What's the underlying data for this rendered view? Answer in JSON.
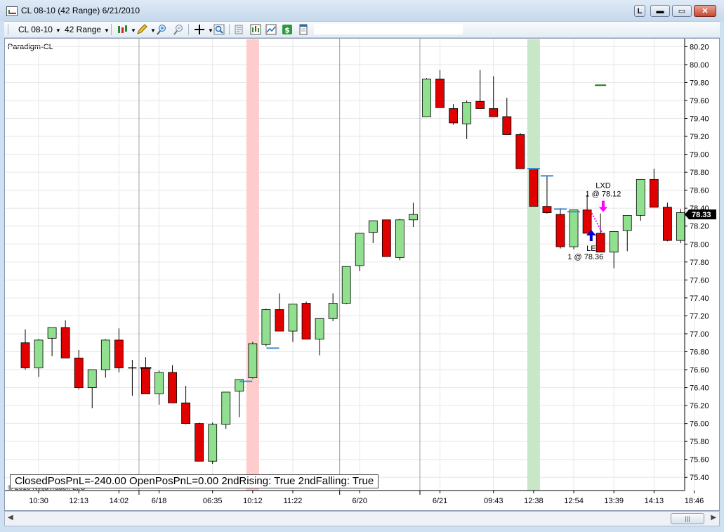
{
  "window": {
    "title": "CL 08-10 (42 Range)  6/21/2010",
    "btn_l": "L",
    "btn_min": "▬",
    "btn_max": "▭",
    "btn_close": "✕"
  },
  "toolbar": {
    "instrument": "CL 08-10",
    "interval": "42 Range",
    "icons": [
      "candle-style-icon",
      "pencil-icon",
      "zoom-in-icon",
      "zoom-out-icon",
      "crosshair-icon",
      "magnifier-icon",
      "properties-icon",
      "strategies-icon",
      "indicators-icon",
      "dollar-icon",
      "data-box-icon"
    ]
  },
  "colors": {
    "up": "#90e090",
    "down": "#e00000",
    "wick": "#000000",
    "red_band": "#ffcccc",
    "green_band": "#c8e6c8",
    "stop_marker": "#3a8fd8",
    "long_arrow": "#0000cc",
    "exit_arrow": "#ff00ff",
    "last_price_bg": "#000000"
  },
  "chart_data": {
    "type": "candlestick",
    "title": "Paradigm-CL",
    "copyright": "© 2010 NinjaTrader, LLC",
    "ylim": [
      75.3,
      80.25
    ],
    "y_ticks": [
      "80.20",
      "80.00",
      "79.80",
      "79.60",
      "79.40",
      "79.20",
      "79.00",
      "78.80",
      "78.60",
      "78.40",
      "78.20",
      "78.00",
      "77.80",
      "77.60",
      "77.40",
      "77.20",
      "77.00",
      "76.80",
      "76.60",
      "76.40",
      "76.20",
      "76.00",
      "75.80",
      "75.60",
      "75.40"
    ],
    "x_ticks": [
      {
        "bar": 1,
        "label": "10:30"
      },
      {
        "bar": 4,
        "label": "12:13"
      },
      {
        "bar": 7,
        "label": "14:02"
      },
      {
        "bar": 10,
        "label": "6/18"
      },
      {
        "bar": 14,
        "label": "06:35"
      },
      {
        "bar": 17,
        "label": "10:12"
      },
      {
        "bar": 20,
        "label": "11:22"
      },
      {
        "bar": 25,
        "label": "6/20"
      },
      {
        "bar": 31,
        "label": "6/21"
      },
      {
        "bar": 35,
        "label": "09:43"
      },
      {
        "bar": 38,
        "label": "12:38"
      },
      {
        "bar": 41,
        "label": "12:54"
      },
      {
        "bar": 44,
        "label": "13:39"
      },
      {
        "bar": 47,
        "label": "14:13"
      },
      {
        "bar": 50,
        "label": "18:46"
      }
    ],
    "session_breaks": [
      9,
      24,
      30
    ],
    "bars": [
      {
        "o": 76.9,
        "h": 77.05,
        "l": 76.6,
        "c": 76.62
      },
      {
        "o": 76.62,
        "h": 76.94,
        "l": 76.52,
        "c": 76.93
      },
      {
        "o": 76.95,
        "h": 77.07,
        "l": 76.75,
        "c": 77.07
      },
      {
        "o": 77.07,
        "h": 77.15,
        "l": 76.73,
        "c": 76.73
      },
      {
        "o": 76.73,
        "h": 76.82,
        "l": 76.38,
        "c": 76.4
      },
      {
        "o": 76.4,
        "h": 76.6,
        "l": 76.17,
        "c": 76.6
      },
      {
        "o": 76.6,
        "h": 76.94,
        "l": 76.51,
        "c": 76.93
      },
      {
        "o": 76.93,
        "h": 77.06,
        "l": 76.57,
        "c": 76.62
      },
      {
        "o": 76.62,
        "h": 76.71,
        "l": 76.31,
        "c": 76.62
      },
      {
        "o": 76.62,
        "h": 76.74,
        "l": 76.33,
        "c": 76.33
      },
      {
        "o": 76.33,
        "h": 76.59,
        "l": 76.21,
        "c": 76.57
      },
      {
        "o": 76.57,
        "h": 76.65,
        "l": 76.24,
        "c": 76.23
      },
      {
        "o": 76.23,
        "h": 76.42,
        "l": 75.99,
        "c": 76.0
      },
      {
        "o": 76.0,
        "h": 76.01,
        "l": 75.58,
        "c": 75.58
      },
      {
        "o": 75.58,
        "h": 76.01,
        "l": 75.55,
        "c": 75.99
      },
      {
        "o": 75.99,
        "h": 76.35,
        "l": 75.94,
        "c": 76.35
      },
      {
        "o": 76.36,
        "h": 76.49,
        "l": 76.07,
        "c": 76.49
      },
      {
        "o": 76.51,
        "h": 76.91,
        "l": 76.5,
        "c": 76.89
      },
      {
        "o": 76.88,
        "h": 77.28,
        "l": 76.86,
        "c": 77.27
      },
      {
        "o": 77.27,
        "h": 77.45,
        "l": 77.03,
        "c": 77.03
      },
      {
        "o": 77.03,
        "h": 77.33,
        "l": 76.91,
        "c": 77.33
      },
      {
        "o": 77.34,
        "h": 77.36,
        "l": 76.94,
        "c": 76.94
      },
      {
        "o": 76.94,
        "h": 77.17,
        "l": 76.76,
        "c": 77.17
      },
      {
        "o": 77.17,
        "h": 77.45,
        "l": 77.14,
        "c": 77.34
      },
      {
        "o": 77.34,
        "h": 77.75,
        "l": 77.33,
        "c": 77.75
      },
      {
        "o": 77.76,
        "h": 78.12,
        "l": 77.7,
        "c": 78.12
      },
      {
        "o": 78.13,
        "h": 78.26,
        "l": 78.01,
        "c": 78.26
      },
      {
        "o": 78.27,
        "h": 78.27,
        "l": 77.86,
        "c": 77.86
      },
      {
        "o": 77.85,
        "h": 78.28,
        "l": 77.82,
        "c": 78.27
      },
      {
        "o": 78.27,
        "h": 78.46,
        "l": 78.19,
        "c": 78.33
      },
      {
        "o": 79.42,
        "h": 79.85,
        "l": 79.42,
        "c": 79.84
      },
      {
        "o": 79.84,
        "h": 79.94,
        "l": 79.52,
        "c": 79.52
      },
      {
        "o": 79.51,
        "h": 79.56,
        "l": 79.33,
        "c": 79.35
      },
      {
        "o": 79.34,
        "h": 79.6,
        "l": 79.17,
        "c": 79.58
      },
      {
        "o": 79.59,
        "h": 79.94,
        "l": 79.52,
        "c": 79.51
      },
      {
        "o": 79.51,
        "h": 79.87,
        "l": 79.42,
        "c": 79.42
      },
      {
        "o": 79.42,
        "h": 79.63,
        "l": 79.22,
        "c": 79.22
      },
      {
        "o": 79.22,
        "h": 79.24,
        "l": 78.84,
        "c": 78.84
      },
      {
        "o": 78.84,
        "h": 78.84,
        "l": 78.42,
        "c": 78.42
      },
      {
        "o": 78.42,
        "h": 78.76,
        "l": 78.34,
        "c": 78.35
      },
      {
        "o": 78.33,
        "h": 78.4,
        "l": 77.95,
        "c": 77.97
      },
      {
        "o": 77.97,
        "h": 78.38,
        "l": 77.94,
        "c": 78.38
      },
      {
        "o": 78.38,
        "h": 78.55,
        "l": 78.12,
        "c": 78.12
      },
      {
        "o": 78.12,
        "h": 78.34,
        "l": 77.91,
        "c": 77.91
      },
      {
        "o": 77.91,
        "h": 78.14,
        "l": 77.73,
        "c": 78.14
      },
      {
        "o": 78.15,
        "h": 78.32,
        "l": 77.92,
        "c": 78.32
      },
      {
        "o": 78.32,
        "h": 78.72,
        "l": 78.26,
        "c": 78.72
      },
      {
        "o": 78.72,
        "h": 78.84,
        "l": 78.42,
        "c": 78.41
      },
      {
        "o": 78.41,
        "h": 78.46,
        "l": 78.03,
        "c": 78.04
      },
      {
        "o": 78.04,
        "h": 78.39,
        "l": 78.01,
        "c": 78.35
      }
    ],
    "bands": [
      {
        "bar": 17,
        "color": "red"
      },
      {
        "bar": 38,
        "color": "green"
      }
    ],
    "stop_markers": [
      {
        "bar": 16.5,
        "y": 76.47
      },
      {
        "bar": 18.5,
        "y": 76.84
      },
      {
        "bar": 38,
        "y": 78.84
      },
      {
        "bar": 39,
        "y": 78.76
      },
      {
        "bar": 40,
        "y": 78.39
      },
      {
        "bar": 41,
        "y": 78.36
      }
    ],
    "dark_markers": [
      {
        "bar": 9,
        "y": 76.62
      },
      {
        "bar": 43,
        "y": 79.77
      }
    ],
    "trades": {
      "entry": {
        "bar": 42.3,
        "price": 78.36,
        "label": "LE",
        "detail": "1 @ 78.36"
      },
      "exit": {
        "bar": 43.2,
        "price": 78.12,
        "label": "LXD",
        "detail": "1 @ 78.12"
      }
    },
    "last_price": "78.33",
    "status_text": "ClosedPosPnL=-240.00 OpenPosPnL=0.00 2ndRising: True 2ndFalling: True"
  }
}
